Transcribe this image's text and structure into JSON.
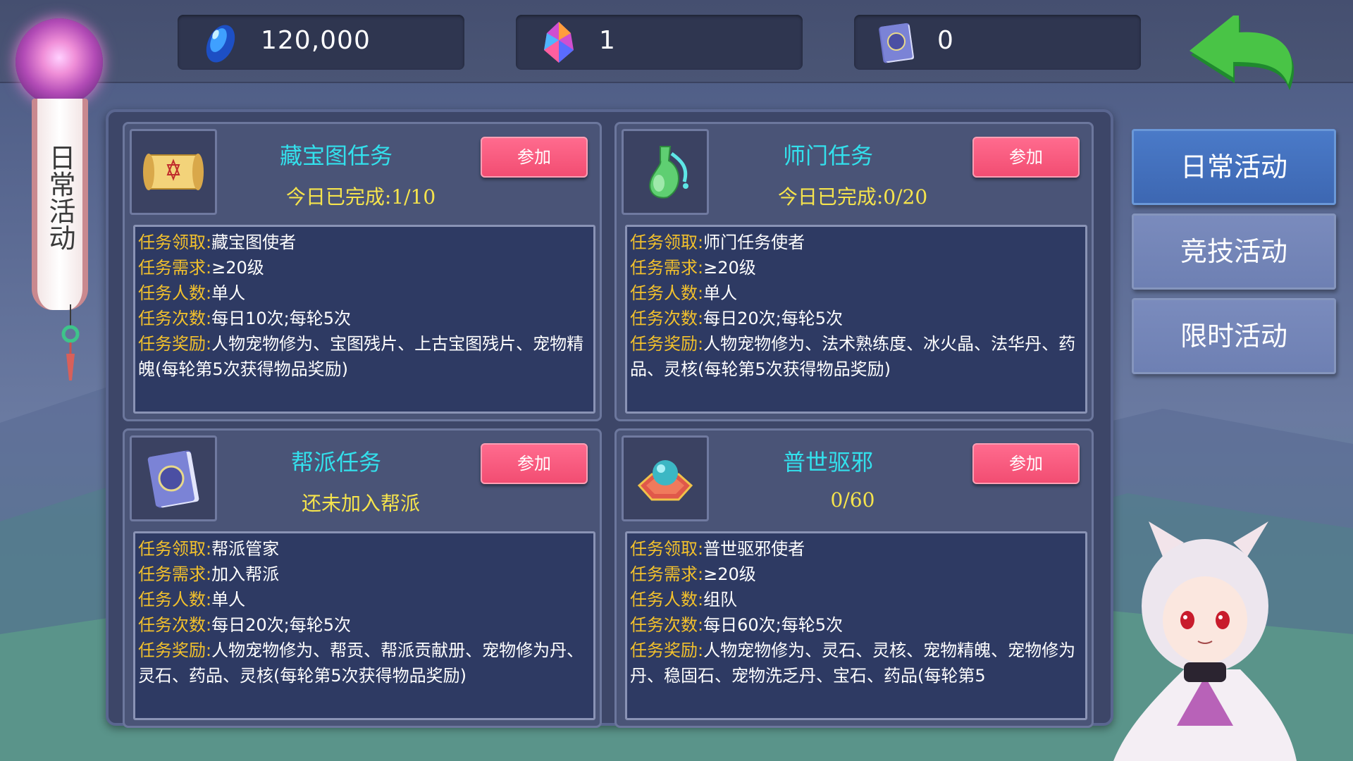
{
  "resources": [
    {
      "icon": "blue-gem-icon",
      "value": "120,000"
    },
    {
      "icon": "rainbow-crystal-icon",
      "value": "1"
    },
    {
      "icon": "contribution-book-icon",
      "value": "0"
    }
  ],
  "side_banner": {
    "title": "日常活动"
  },
  "labels": {
    "receive": "任务领取:",
    "requirement": "任务需求:",
    "members": "任务人数:",
    "times": "任务次数:",
    "reward": "任务奖励:"
  },
  "cards": [
    {
      "title": "藏宝图任务",
      "progress": "今日已完成:1/10",
      "join_label": "参加",
      "icon": "treasure-map-scroll-icon",
      "receive": "藏宝图使者",
      "requirement": "≥20级",
      "members": "单人",
      "times": "每日10次;每轮5次",
      "reward": "人物宠物修为、宝图残片、上古宝图残片、宠物精魄(每轮第5次获得物品奖励)"
    },
    {
      "title": "师门任务",
      "progress": "今日已完成:0/20",
      "join_label": "参加",
      "icon": "jade-vase-icon",
      "receive": "师门任务使者",
      "requirement": "≥20级",
      "members": "单人",
      "times": "每日20次;每轮5次",
      "reward": "人物宠物修为、法术熟练度、冰火晶、法华丹、药品、灵核(每轮第5次获得物品奖励)"
    },
    {
      "title": "帮派任务",
      "progress": "还未加入帮派",
      "join_label": "参加",
      "icon": "contribution-book-icon",
      "receive": "帮派管家",
      "requirement": "加入帮派",
      "members": "单人",
      "times": "每日20次;每轮5次",
      "reward": "人物宠物修为、帮贡、帮派贡献册、宠物修为丹、灵石、药品、灵核(每轮第5次获得物品奖励)"
    },
    {
      "title": "普世驱邪",
      "progress": "0/60",
      "join_label": "参加",
      "icon": "orb-pedestal-icon",
      "receive": "普世驱邪使者",
      "requirement": "≥20级",
      "members": "组队",
      "times": "每日60次;每轮5次",
      "reward": "人物宠物修为、灵石、灵核、宠物精魄、宠物修为丹、稳固石、宠物洗乏丹、宝石、药品(每轮第5"
    }
  ],
  "tabs": [
    {
      "label": "日常活动",
      "active": true
    },
    {
      "label": "竞技活动",
      "active": false
    },
    {
      "label": "限时活动",
      "active": false
    }
  ]
}
